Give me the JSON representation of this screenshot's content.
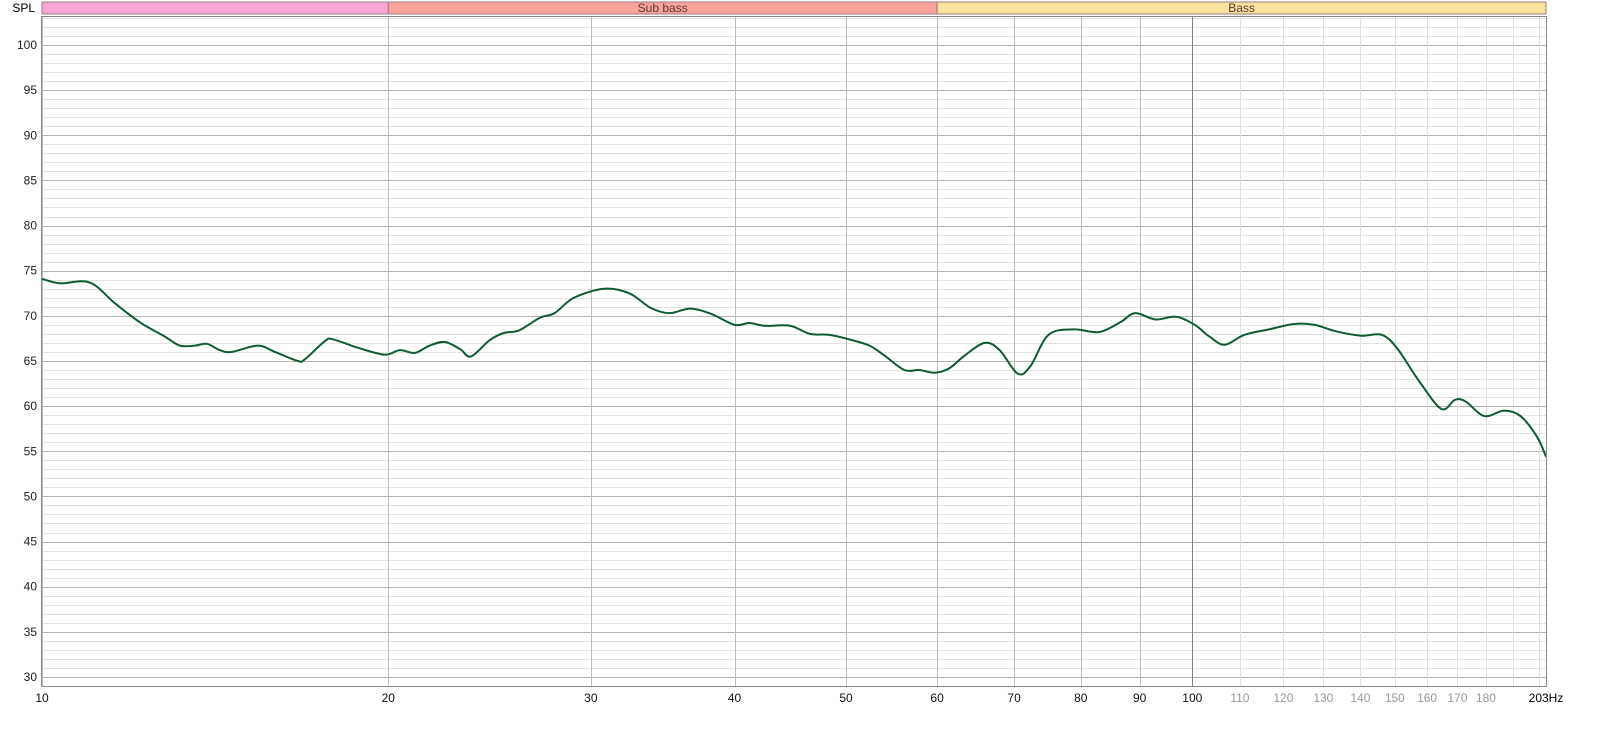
{
  "chart_data": {
    "type": "line",
    "title": "",
    "ylabel": "SPL",
    "xunit": "Hz",
    "xscale": "log",
    "xlim": [
      10,
      203
    ],
    "ylim": [
      29,
      103.1
    ],
    "grid": true,
    "yticks": [
      30,
      35,
      40,
      45,
      50,
      55,
      60,
      65,
      70,
      75,
      80,
      85,
      90,
      95,
      100
    ],
    "xticks_major": [
      {
        "v": 10,
        "label": "10"
      },
      {
        "v": 20,
        "label": "20"
      },
      {
        "v": 30,
        "label": "30"
      },
      {
        "v": 40,
        "label": "40"
      },
      {
        "v": 50,
        "label": "50"
      },
      {
        "v": 60,
        "label": "60"
      },
      {
        "v": 70,
        "label": "70"
      },
      {
        "v": 80,
        "label": "80"
      },
      {
        "v": 90,
        "label": "90"
      },
      {
        "v": 100,
        "label": "100"
      }
    ],
    "xticks_minor": [
      {
        "v": 110,
        "label": "110"
      },
      {
        "v": 120,
        "label": "120"
      },
      {
        "v": 130,
        "label": "130"
      },
      {
        "v": 140,
        "label": "140"
      },
      {
        "v": 150,
        "label": "150"
      },
      {
        "v": 160,
        "label": "160"
      },
      {
        "v": 170,
        "label": "170"
      },
      {
        "v": 180,
        "label": "180"
      },
      {
        "v": 190,
        "label": ""
      },
      {
        "v": 200,
        "label": ""
      }
    ],
    "x_end_label": "203Hz",
    "bands": [
      {
        "label": "",
        "from": 10,
        "to": 20,
        "color": "#f9a6d4"
      },
      {
        "label": "Sub bass",
        "from": 20,
        "to": 60,
        "color": "#f9a29e"
      },
      {
        "label": "Bass",
        "from": 60,
        "to": 203,
        "color": "#f9e39c"
      }
    ],
    "series": [
      {
        "name": "SPL",
        "color": "#0d5c30",
        "points": [
          [
            10,
            74.1
          ],
          [
            10.37,
            73.6
          ],
          [
            11.0,
            73.7
          ],
          [
            11.57,
            71.4
          ],
          [
            12.16,
            69.3
          ],
          [
            12.79,
            67.7
          ],
          [
            13.18,
            66.7
          ],
          [
            13.58,
            66.7
          ],
          [
            13.91,
            66.9
          ],
          [
            14.28,
            66.2
          ],
          [
            14.62,
            66.0
          ],
          [
            15.4,
            66.7
          ],
          [
            15.94,
            66.0
          ],
          [
            16.69,
            65.0
          ],
          [
            16.93,
            65.2
          ],
          [
            17.62,
            67.2
          ],
          [
            17.9,
            67.4
          ],
          [
            18.89,
            66.4
          ],
          [
            19.86,
            65.7
          ],
          [
            20.47,
            66.2
          ],
          [
            21.1,
            65.9
          ],
          [
            21.72,
            66.7
          ],
          [
            22.4,
            67.1
          ],
          [
            23.1,
            66.3
          ],
          [
            23.6,
            65.5
          ],
          [
            24.5,
            67.3
          ],
          [
            25.2,
            68.1
          ],
          [
            26.0,
            68.4
          ],
          [
            27.1,
            69.8
          ],
          [
            27.9,
            70.3
          ],
          [
            29.0,
            72.0
          ],
          [
            30.8,
            73.0
          ],
          [
            32.4,
            72.5
          ],
          [
            33.8,
            70.9
          ],
          [
            35.1,
            70.3
          ],
          [
            36.6,
            70.8
          ],
          [
            38.2,
            70.2
          ],
          [
            40.0,
            69.0
          ],
          [
            41.2,
            69.2
          ],
          [
            42.5,
            68.9
          ],
          [
            44.7,
            68.9
          ],
          [
            46.5,
            68.0
          ],
          [
            48.3,
            67.9
          ],
          [
            50.3,
            67.4
          ],
          [
            52.4,
            66.7
          ],
          [
            54.0,
            65.6
          ],
          [
            56.2,
            64.0
          ],
          [
            57.9,
            64.0
          ],
          [
            59.7,
            63.7
          ],
          [
            61.5,
            64.2
          ],
          [
            63.4,
            65.6
          ],
          [
            66.0,
            67.0
          ],
          [
            68.0,
            66.2
          ],
          [
            70.5,
            63.6
          ],
          [
            72.3,
            64.4
          ],
          [
            75.0,
            67.9
          ],
          [
            78.9,
            68.5
          ],
          [
            83.0,
            68.2
          ],
          [
            86.6,
            69.3
          ],
          [
            89.2,
            70.3
          ],
          [
            92.9,
            69.6
          ],
          [
            96.8,
            69.9
          ],
          [
            100.5,
            69.0
          ],
          [
            103.5,
            67.7
          ],
          [
            106.7,
            66.8
          ],
          [
            111.0,
            67.9
          ],
          [
            116.6,
            68.5
          ],
          [
            122.6,
            69.1
          ],
          [
            127.8,
            69.0
          ],
          [
            133.2,
            68.3
          ],
          [
            140.2,
            67.8
          ],
          [
            146.1,
            67.9
          ],
          [
            150.7,
            66.4
          ],
          [
            157.2,
            62.9
          ],
          [
            164.6,
            59.7
          ],
          [
            169.2,
            60.7
          ],
          [
            172.9,
            60.5
          ],
          [
            179.4,
            58.9
          ],
          [
            186.6,
            59.5
          ],
          [
            192.9,
            58.9
          ],
          [
            199.4,
            56.6
          ],
          [
            203,
            54.4
          ]
        ]
      }
    ]
  }
}
